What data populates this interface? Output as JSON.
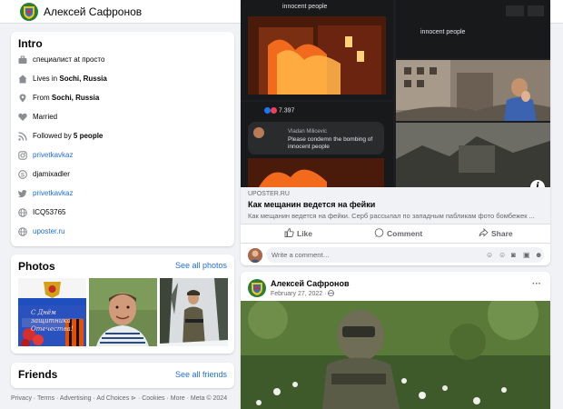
{
  "topbar": {
    "name": "Алексей Сафронов",
    "more": "···"
  },
  "intro": {
    "title": "Intro",
    "items": [
      {
        "icon": "briefcase-icon",
        "text": "специалист at просто"
      },
      {
        "icon": "home-icon",
        "prefix": "Lives in ",
        "bold": "Sochi, Russia"
      },
      {
        "icon": "location-pin-icon",
        "prefix": "From ",
        "bold": "Sochi, Russia"
      },
      {
        "icon": "heart-icon",
        "text": "Married"
      },
      {
        "icon": "rss-icon",
        "prefix": "Followed by ",
        "bold": "5 people"
      },
      {
        "icon": "instagram-icon",
        "text": "privetkavkaz",
        "link": true
      },
      {
        "icon": "skype-icon",
        "text": "djamixadler"
      },
      {
        "icon": "twitter-icon",
        "text": "privetkavkaz",
        "link": true
      },
      {
        "icon": "globe-icon",
        "text": "ICQ53765"
      },
      {
        "icon": "globe-icon",
        "text": "uposter.ru",
        "link": true
      }
    ]
  },
  "photos": {
    "title": "Photos",
    "see_all": "See all photos",
    "card_text": "С Днём защитника Отечества!"
  },
  "friends": {
    "title": "Friends",
    "see_all": "See all friends"
  },
  "footer": "Privacy · Terms · Advertising · Ad Choices ⊳ · Cookies · More · Meta © 2024",
  "post1": {
    "collage": {
      "caption_top_left": "innocent people",
      "caption_top_right": "innocent people",
      "likes": "7.397",
      "comment_author": "Vladan Milicevic",
      "comment_text": "Please condemn the bombing of innocent people"
    },
    "link": {
      "domain": "UPOSTER.RU",
      "title": "Как мещанин ведется на фейки",
      "description": "Как мещанин ведется на фейки. Серб рассылал по западным пабликам фото бомбежек ..."
    },
    "actions": {
      "like": "Like",
      "comment": "Comment",
      "share": "Share"
    },
    "comment_placeholder": "Write a comment…"
  },
  "post2": {
    "author": "Алексей Сафронов",
    "date": "February 27, 2022 · ",
    "more": "···"
  },
  "colors": {
    "link": "#216fdb",
    "bg": "#f0f2f5",
    "card": "#ffffff",
    "muted": "#65676b"
  }
}
